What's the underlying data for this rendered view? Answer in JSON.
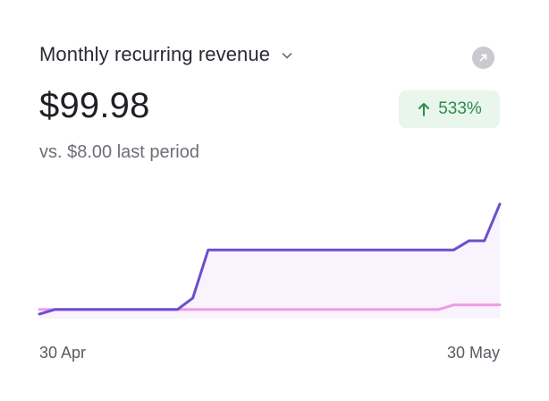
{
  "metric": {
    "title": "Monthly recurring revenue",
    "value": "$99.98",
    "change": "533%",
    "comparison": "vs. $8.00 last period"
  },
  "colors": {
    "primary_line": "#6a4fcf",
    "secondary_line": "#ef9be3",
    "area_fill": "#f8f3fd",
    "badge_bg": "#e8f6ec",
    "badge_text": "#2e8a4d"
  },
  "icons": {
    "dropdown": "chevron-down-icon",
    "expand": "arrow-up-right-icon",
    "trend": "arrow-up-icon"
  },
  "chart_data": {
    "type": "line",
    "x_labels": [
      "30 Apr",
      "30 May"
    ],
    "x": [
      0,
      1,
      2,
      3,
      4,
      5,
      6,
      7,
      8,
      9,
      10,
      11,
      12,
      13,
      14,
      15,
      16,
      17,
      18,
      19,
      20,
      21,
      22,
      23,
      24,
      25,
      26,
      27,
      28,
      29,
      30
    ],
    "series": [
      {
        "values": [
          4,
          8,
          8,
          8,
          8,
          8,
          8,
          8,
          8,
          8,
          18,
          60,
          60,
          60,
          60,
          60,
          60,
          60,
          60,
          60,
          60,
          60,
          60,
          60,
          60,
          60,
          60,
          60,
          68,
          68,
          100
        ],
        "color": "#6a4fcf",
        "fill": true
      },
      {
        "values": [
          8,
          8,
          8,
          8,
          8,
          8,
          8,
          8,
          8,
          8,
          8,
          8,
          8,
          8,
          8,
          8,
          8,
          8,
          8,
          8,
          8,
          8,
          8,
          8,
          8,
          8,
          8,
          12,
          12,
          12,
          12
        ],
        "color": "#ef9be3",
        "fill": false
      }
    ],
    "ylim": [
      0,
      100
    ],
    "grid": false,
    "legend": "none"
  }
}
